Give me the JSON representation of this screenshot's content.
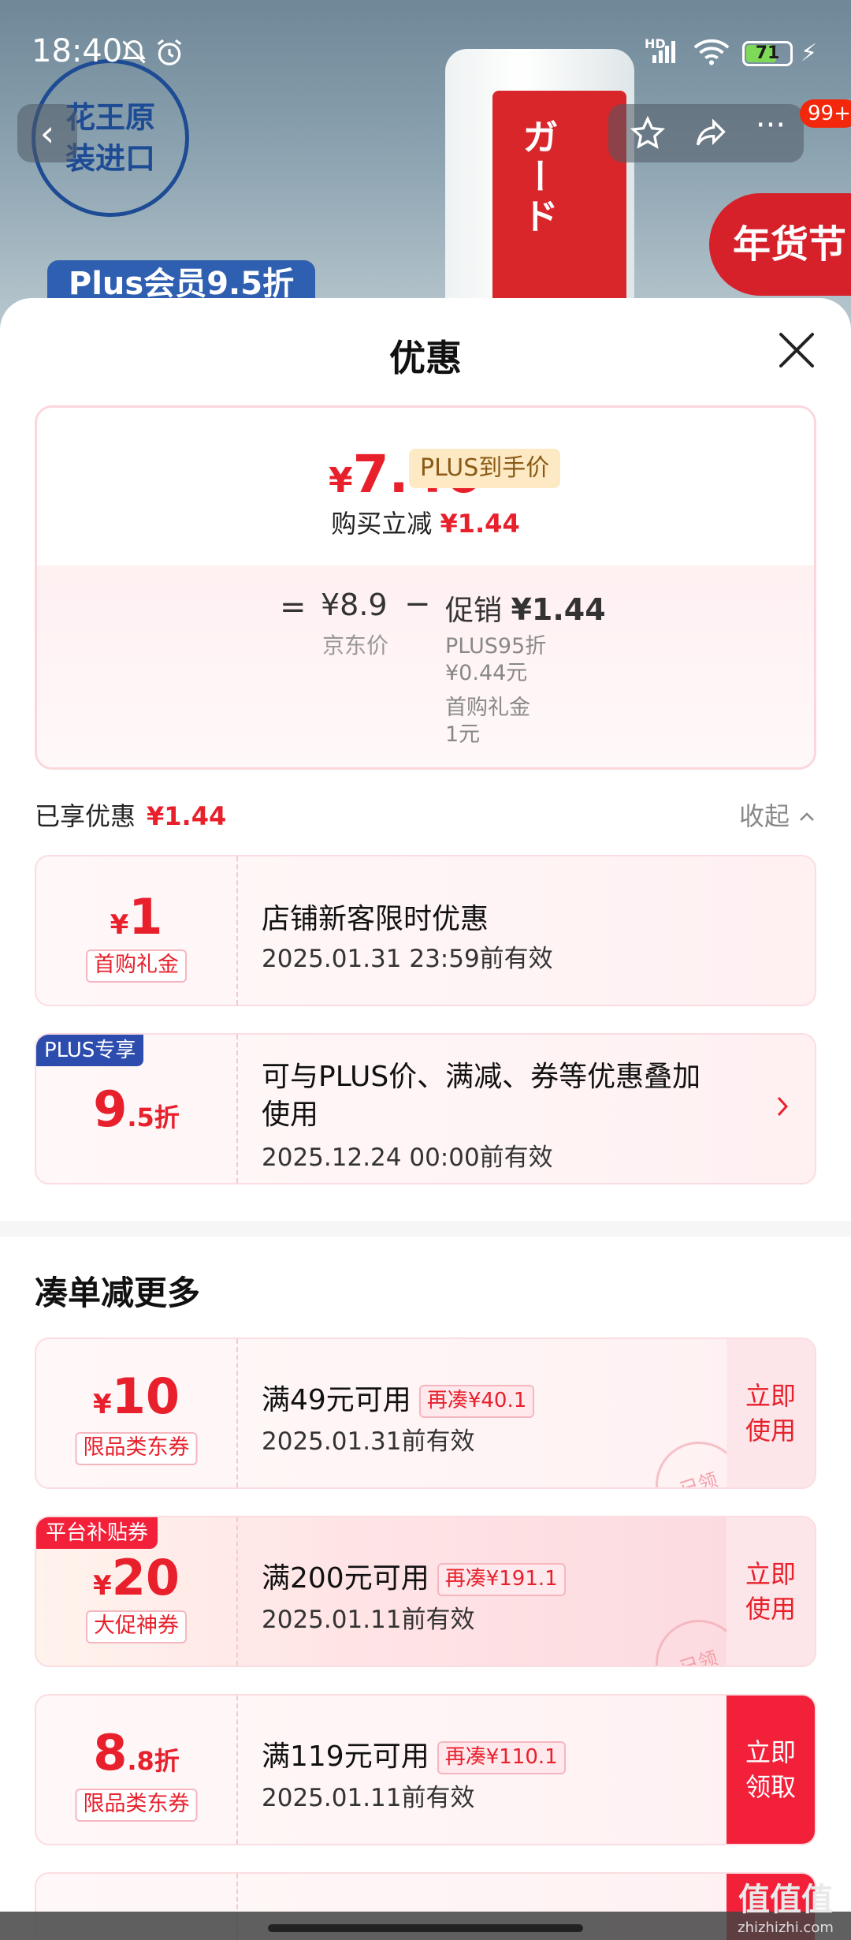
{
  "status_bar": {
    "time": "18:40",
    "battery": "71",
    "battery_level": 0.71,
    "net": "HD"
  },
  "hero": {
    "badge": "花王原装进口",
    "plus_banner": "Plus会员9.5折",
    "festival": "年货节",
    "product": "ガード"
  },
  "nav": {
    "cart_badge": "99+",
    "back_icon": "chevron-left-icon",
    "favorite_icon": "star-icon",
    "share_icon": "share-icon",
    "more_icon": "more-icon"
  },
  "sheet": {
    "title": "优惠"
  },
  "summary": {
    "price_yen": "¥",
    "price": "7.46",
    "plus_tag": "PLUS到手价",
    "buy_reduce_label": "购买立减",
    "buy_reduce_value": "¥1.44",
    "eq": "=",
    "jd_price": "¥8.9",
    "jd_label": "京东价",
    "minus": "−",
    "promo_label": "促销",
    "promo_value": "¥1.44",
    "promo_lines": [
      "PLUS95折",
      "¥0.44元",
      "首购礼金",
      "1元"
    ]
  },
  "enjoyed": {
    "label": "已享优惠",
    "value": "¥1.44",
    "collapse": "收起"
  },
  "enjoyed_coupons": [
    {
      "amount_yen": "¥",
      "amount": "1",
      "suffix": "",
      "tag": "首购礼金",
      "title": "店铺新客限时优惠",
      "validity": "2025.01.31 23:59前有效"
    },
    {
      "badge": "PLUS专享",
      "amount": "9",
      "suffix": ".5折",
      "title_line1": "可与PLUS价、满减、券等优惠叠加",
      "title_line2": "使用",
      "validity": "2025.12.24 00:00前有效"
    }
  ],
  "more_section": {
    "title": "凑单减更多"
  },
  "more_coupons": [
    {
      "amount_yen": "¥",
      "amount": "10",
      "tag": "限品类东券",
      "title": "满49元可用",
      "gap": "再凑¥40.1",
      "validity": "2025.01.31前有效",
      "action": "立即使用",
      "stamp": "已领"
    },
    {
      "badge": "平台补贴券",
      "amount_yen": "¥",
      "amount": "20",
      "tag": "大促神券",
      "title": "满200元可用",
      "gap": "再凑¥191.1",
      "validity": "2025.01.11前有效",
      "action": "立即使用",
      "stamp": "已领"
    },
    {
      "amount": "8",
      "suffix": ".8折",
      "tag": "限品类东券",
      "title": "满119元可用",
      "gap": "再凑¥110.1",
      "validity": "2025.01.11前有效",
      "action": "立即领取"
    }
  ],
  "watermark": {
    "brand": "值值值",
    "site": "zhizhizhi.com"
  }
}
